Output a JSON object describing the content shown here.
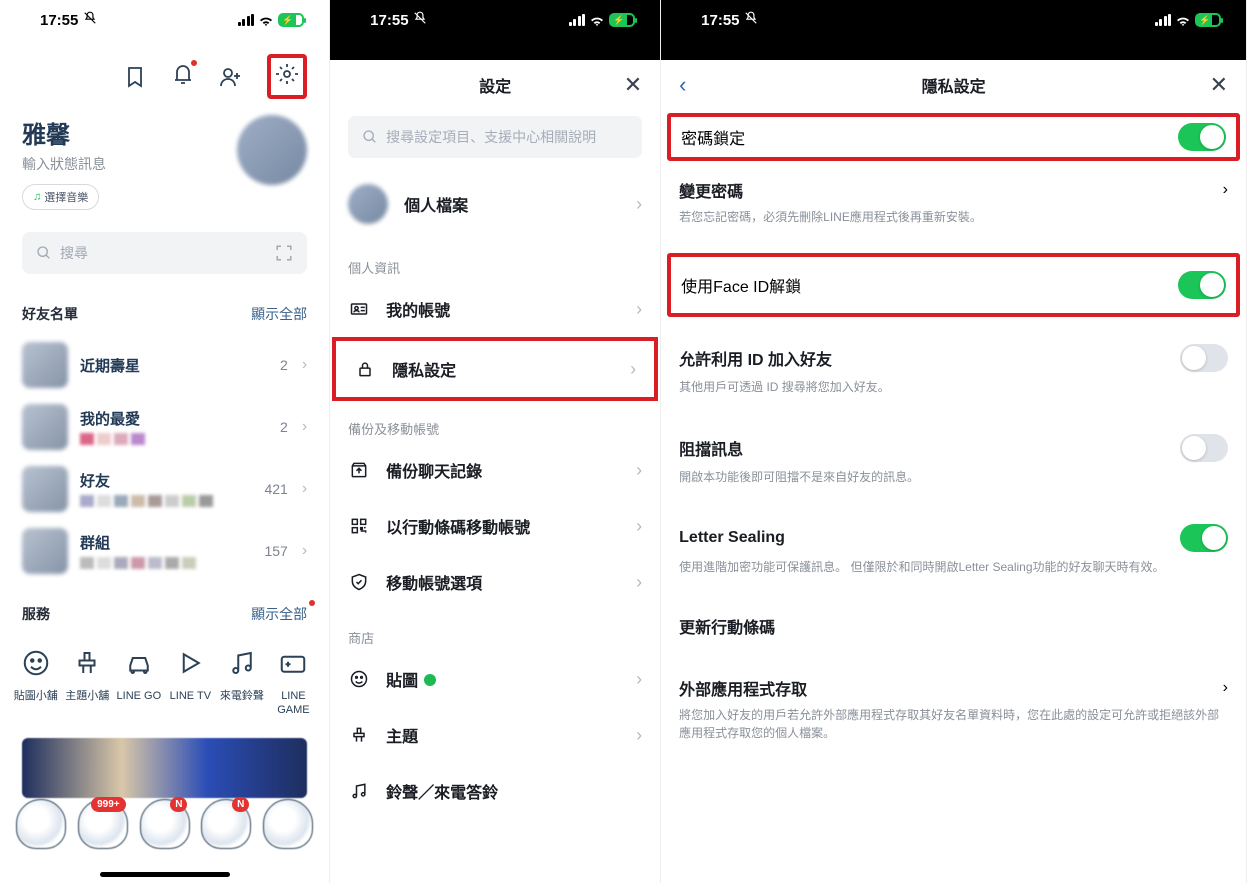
{
  "status": {
    "time": "17:55"
  },
  "s1": {
    "username": "雅馨",
    "status_hint": "輸入狀態訊息",
    "music_chip": "選擇音樂",
    "search_placeholder": "搜尋",
    "friends_header": "好友名單",
    "show_all": "顯示全部",
    "rows": [
      {
        "title": "近期壽星",
        "count": "2"
      },
      {
        "title": "我的最愛",
        "count": "2"
      },
      {
        "title": "好友",
        "count": "421"
      },
      {
        "title": "群組",
        "count": "157"
      }
    ],
    "services_header": "服務",
    "services_link": "顯示全部",
    "services": [
      "貼圖小舖",
      "主題小舖",
      "LINE GO",
      "LINE TV",
      "來電鈴聲",
      "LINE\nGAME"
    ],
    "badge999": "999+"
  },
  "s2": {
    "title": "設定",
    "search_placeholder": "搜尋設定項目、支援中心相關說明",
    "profile": "個人檔案",
    "g1": "個人資訊",
    "r_account": "我的帳號",
    "r_privacy": "隱私設定",
    "g2": "備份及移動帳號",
    "r_backup": "備份聊天記錄",
    "r_qrmove": "以行動條碼移動帳號",
    "r_moveopt": "移動帳號選項",
    "g3": "商店",
    "r_sticker": "貼圖",
    "r_theme": "主題",
    "r_ring": "鈴聲／來電答鈴"
  },
  "s3": {
    "title": "隱私設定",
    "r_lock": "密碼鎖定",
    "r_changepw": "變更密碼",
    "r_changepw_sub": "若您忘記密碼，必須先刪除LINE應用程式後再重新安裝。",
    "r_faceid": "使用Face ID解鎖",
    "r_allowid": "允許利用 ID 加入好友",
    "r_allowid_sub": "其他用戶可透過 ID 搜尋將您加入好友。",
    "r_block": "阻擋訊息",
    "r_block_sub": "開啟本功能後即可阻擋不是來自好友的訊息。",
    "r_letter": "Letter Sealing",
    "r_letter_sub": "使用進階加密功能可保護訊息。 但僅限於和同時開啟Letter Sealing功能的好友聊天時有效。",
    "r_qr": "更新行動條碼",
    "r_ext": "外部應用程式存取",
    "r_ext_sub": "將您加入好友的用戶若允許外部應用程式存取其好友名單資料時，您在此處的設定可允許或拒絕該外部應用程式存取您的個人檔案。"
  }
}
